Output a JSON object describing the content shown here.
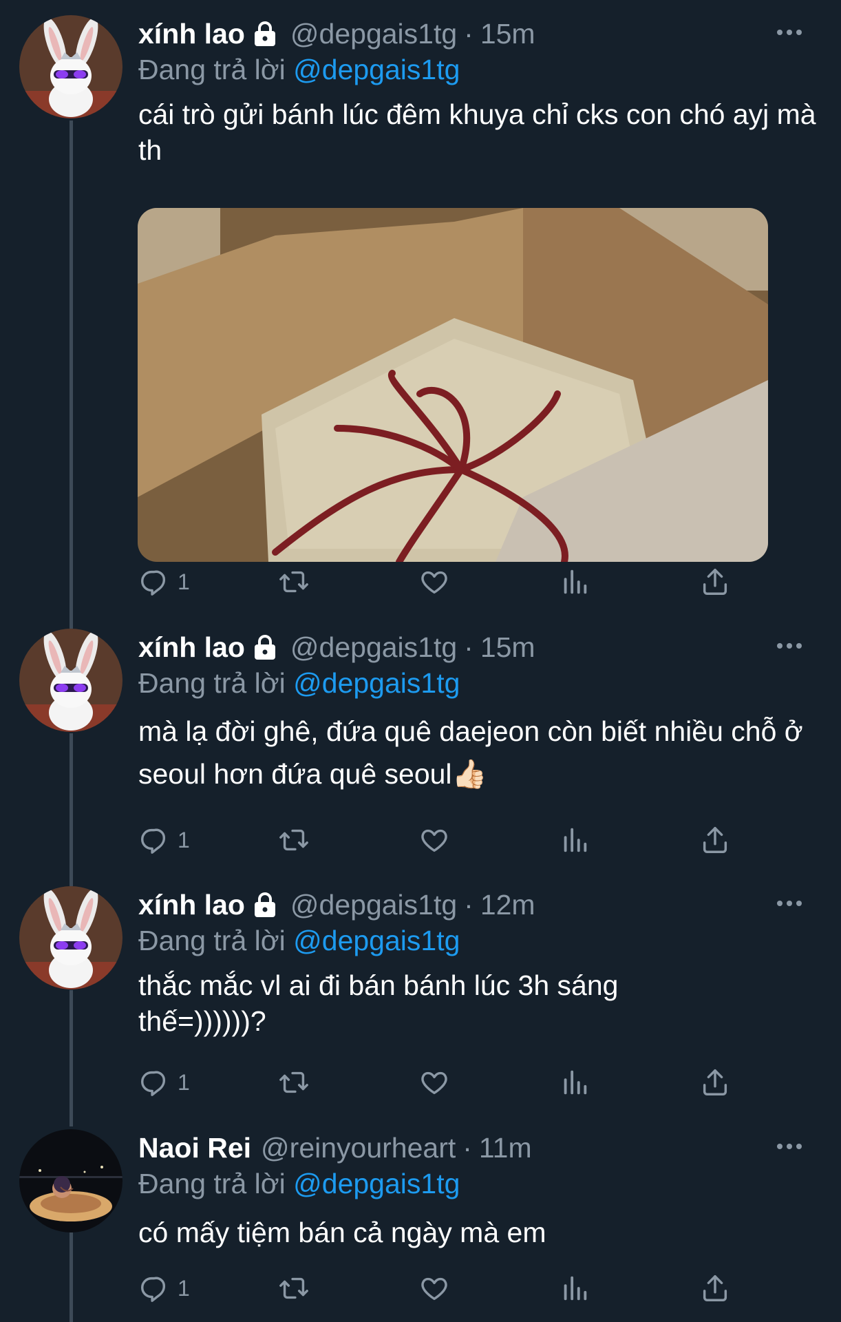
{
  "replying_prefix": "Đang trả lời",
  "tweets": [
    {
      "name": "xính lao",
      "handle": "@depgais1tg",
      "separator": "·",
      "time": "15m",
      "reply_to": "@depgais1tg",
      "text": "cái trò gửi bánh lúc đêm khuya chỉ cks con chó ayj mà th",
      "has_image": true,
      "reply_count": "1"
    },
    {
      "name": "xính lao",
      "handle": "@depgais1tg",
      "separator": "·",
      "time": "15m",
      "reply_to": "@depgais1tg",
      "text": "mà lạ đời ghê, đứa quê daejeon còn biết nhiều chỗ ở seoul hơn đứa quê seoul👍🏻",
      "reply_count": "1"
    },
    {
      "name": "xính lao",
      "handle": "@depgais1tg",
      "separator": "·",
      "time": "12m",
      "reply_to": "@depgais1tg",
      "text": "thắc mắc vl ai đi bán bánh lúc 3h sáng thế=))))))?",
      "reply_count": "1"
    },
    {
      "name": "Naoi Rei",
      "handle": "@reinyourheart",
      "separator": "·",
      "time": "11m",
      "reply_to": "@depgais1tg",
      "text": "có mấy tiệm bán cả ngày mà em",
      "reply_count": "1"
    }
  ],
  "colors": {
    "background": "#15202b",
    "text_primary": "#ffffff",
    "text_secondary": "#8b98a5",
    "link": "#1d9bf0",
    "thread_line": "#3d4a57"
  },
  "icons": [
    "lock-icon",
    "more-icon",
    "reply-icon",
    "retweet-icon",
    "like-icon",
    "views-icon",
    "share-icon"
  ]
}
